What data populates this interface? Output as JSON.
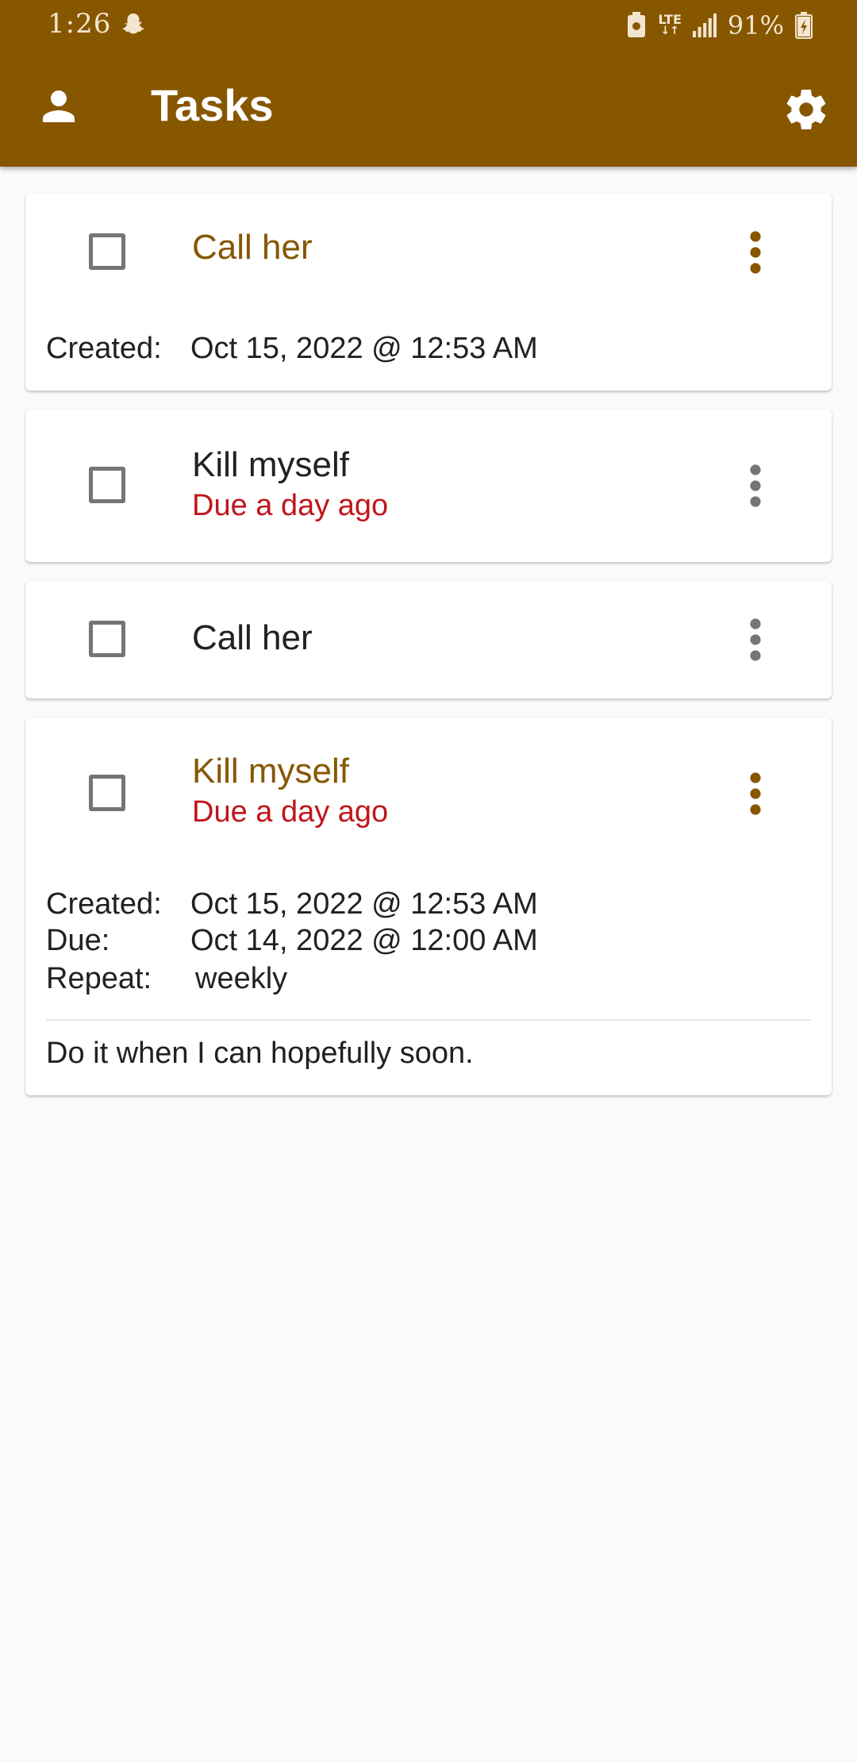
{
  "status_bar": {
    "time": "1:26",
    "network": "LTE",
    "battery": "91%"
  },
  "toolbar": {
    "title": "Tasks",
    "account_icon": "account-icon",
    "settings_icon": "gear-icon"
  },
  "colors": {
    "primary": "#875700",
    "overdue": "#c0161c",
    "background": "#fafafa"
  },
  "tasks": [
    {
      "title": "Call her",
      "expanded": true,
      "details": {
        "created_label": "Created:",
        "created_value": "Oct 15, 2022 @ 12:53 AM"
      }
    },
    {
      "title": "Kill myself",
      "due": "Due a day ago"
    },
    {
      "title": "Call her"
    },
    {
      "title": "Kill myself",
      "due": "Due a day ago",
      "expanded": true,
      "details": {
        "created_label": "Created:",
        "created_value": "Oct 15, 2022 @ 12:53 AM",
        "due_label": "Due:",
        "due_value": "Oct 14, 2022 @ 12:00 AM",
        "repeat_label": "Repeat:",
        "repeat_value": "weekly"
      },
      "notes": "Do it when I can hopefully soon."
    }
  ]
}
